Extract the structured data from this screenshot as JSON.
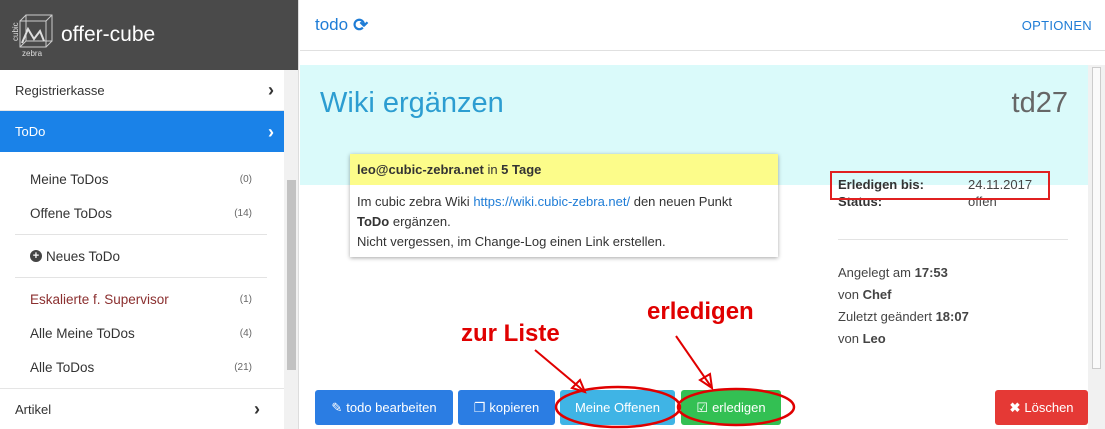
{
  "sidebar": {
    "brand": {
      "logo_text_top": "cubic",
      "logo_text_bottom": "zebra",
      "name": "offer-cube"
    },
    "registrierkasse": "Registrierkasse",
    "todo": "ToDo",
    "items": [
      {
        "label": "Meine ToDos",
        "count": "(0)"
      },
      {
        "label": "Offene ToDos",
        "count": "(14)"
      }
    ],
    "new_todo": "Neues ToDo",
    "items2": [
      {
        "label": "Eskalierte f. Supervisor",
        "count": "(1)"
      },
      {
        "label": "Alle Meine ToDos",
        "count": "(4)"
      },
      {
        "label": "Alle ToDos",
        "count": "(21)"
      }
    ],
    "artikel": "Artikel"
  },
  "topbar": {
    "title": "todo",
    "options": "OPTIONEN"
  },
  "todo": {
    "title": "Wiki ergänzen",
    "id": "td27",
    "card": {
      "assignee": "leo@cubic-zebra.net",
      "in": " in ",
      "due_in": "5 Tage",
      "line1_a": "Im cubic zebra Wiki ",
      "link": "https://wiki.cubic-zebra.net/",
      "line1_b": " den neuen Punkt",
      "bold_word": "ToDo",
      "line2_rest": " ergänzen.",
      "line3": "Nicht vergessen, im Change-Log einen Link erstellen."
    },
    "info": {
      "due_label": "Erledigen bis:",
      "due_value": "24.11.2017",
      "status_label": "Status:",
      "status_value": "offen"
    },
    "meta": {
      "created_prefix": "Angelegt am ",
      "created_time": "17:53",
      "by_prefix": "von ",
      "created_by": "Chef",
      "changed_prefix": "Zuletzt geändert ",
      "changed_time": "18:07",
      "changed_by": "Leo"
    }
  },
  "buttons": {
    "edit": "todo bearbeiten",
    "copy": "kopieren",
    "meine_offenen": "Meine Offenen",
    "erledigen": "erledigen",
    "loeschen": "Löschen"
  },
  "annotations": {
    "zur_liste": "zur Liste",
    "erledigen": "erledigen"
  },
  "colors": {
    "primary": "#1a82e8",
    "highlight": "#fcfc8a",
    "annotation": "#e00000",
    "headband": "#dafafa"
  }
}
